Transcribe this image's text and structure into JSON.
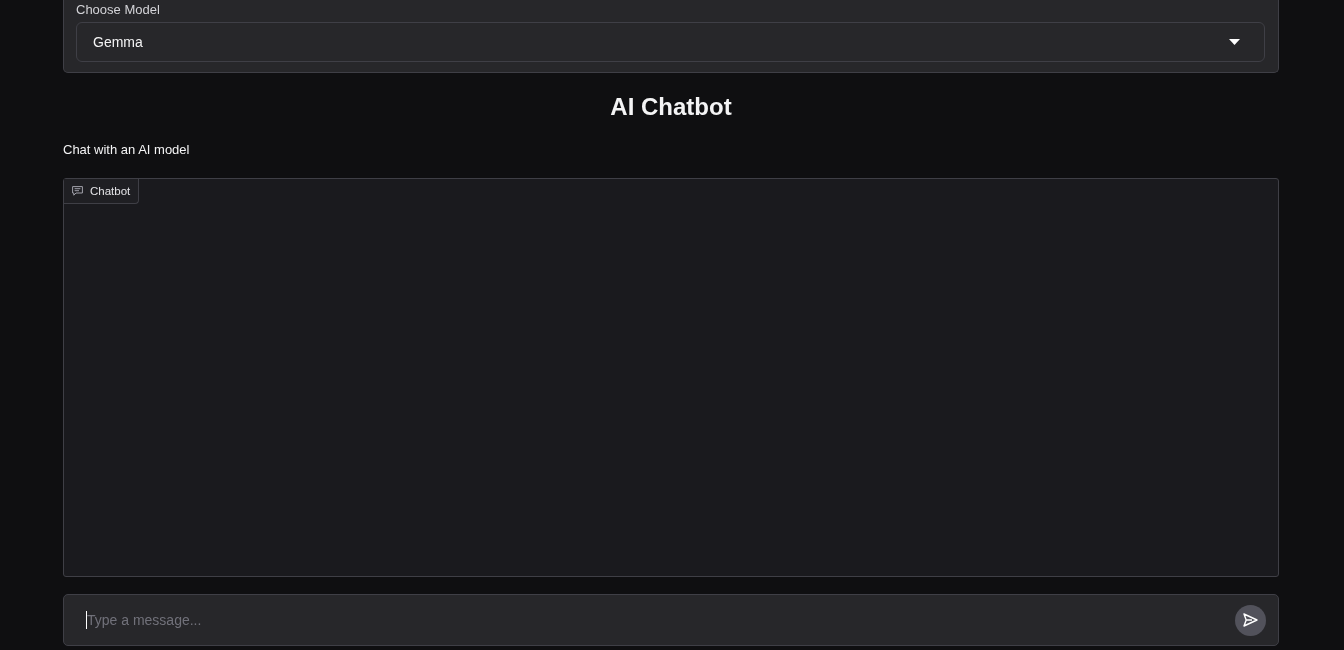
{
  "model_selector": {
    "label": "Choose Model",
    "value": "Gemma"
  },
  "header": {
    "title": "AI Chatbot",
    "subtitle": "Chat with an AI model"
  },
  "chatbot": {
    "label": "Chatbot"
  },
  "message_input": {
    "placeholder": "Type a message...",
    "focused": true
  }
}
